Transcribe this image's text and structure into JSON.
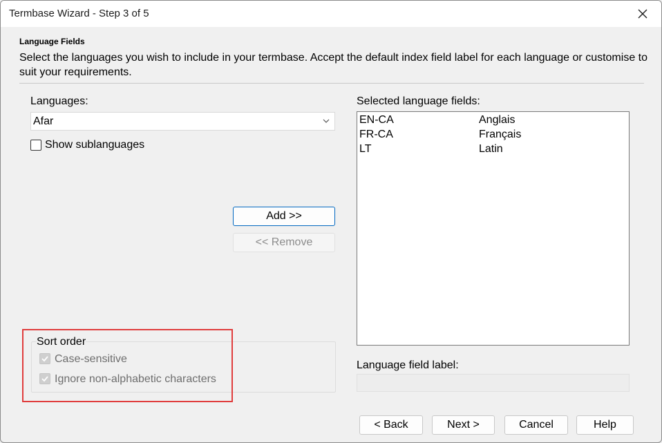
{
  "window": {
    "title": "Termbase Wizard - Step 3 of 5"
  },
  "header": {
    "title": "Language Fields",
    "description": "Select the languages you wish to include in your termbase. Accept the default index field label for each language or customise to suit your requirements."
  },
  "languages": {
    "label": "Languages:",
    "selected": "Afar",
    "show_sublanguages_label": "Show sublanguages",
    "show_sublanguages_checked": false
  },
  "buttons": {
    "add": "Add >>",
    "remove": "<< Remove"
  },
  "selected_fields": {
    "label": "Selected language fields:",
    "items": [
      {
        "code": "EN-CA",
        "name": "Anglais"
      },
      {
        "code": "FR-CA",
        "name": "Français"
      },
      {
        "code": "LT",
        "name": "Latin"
      }
    ]
  },
  "sort_order": {
    "legend": "Sort order",
    "case_sensitive_label": "Case-sensitive",
    "ignore_nonalpha_label": "Ignore non-alphabetic characters"
  },
  "field_label": {
    "label": "Language field label:",
    "value": ""
  },
  "footer": {
    "back": "< Back",
    "next": "Next >",
    "cancel": "Cancel",
    "help": "Help"
  },
  "colors": {
    "highlight": "#e03c3c",
    "primary_border": "#0067c0"
  }
}
